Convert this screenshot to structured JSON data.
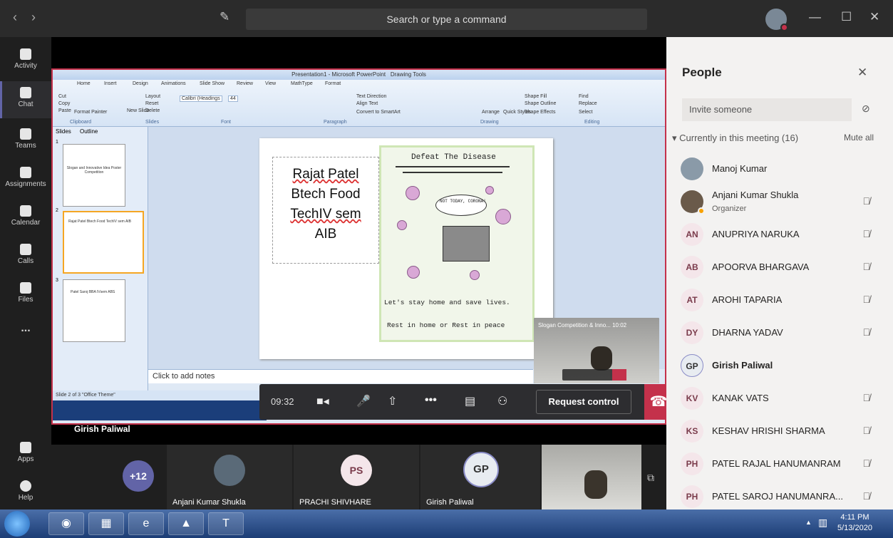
{
  "topbar": {
    "search_placeholder": "Search or type a command",
    "back": "‹",
    "forward": "›"
  },
  "rail": [
    {
      "label": "Activity"
    },
    {
      "label": "Chat"
    },
    {
      "label": "Teams"
    },
    {
      "label": "Assignments"
    },
    {
      "label": "Calendar"
    },
    {
      "label": "Calls"
    },
    {
      "label": "Files"
    },
    {
      "label": "..."
    },
    {
      "label": "Apps"
    },
    {
      "label": "Help"
    }
  ],
  "ppt": {
    "title": "Presentation1 - Microsoft PowerPoint",
    "drawing_tools": "Drawing Tools",
    "tabs": [
      "Home",
      "Insert",
      "Design",
      "Animations",
      "Slide Show",
      "Review",
      "View",
      "MathType",
      "Format"
    ],
    "groups": [
      "Clipboard",
      "Slides",
      "Font",
      "Paragraph",
      "Drawing",
      "Editing"
    ],
    "font_box": "Calibri (Headings",
    "font_size": "44",
    "ribbon_items": [
      "Cut",
      "Copy",
      "Paste",
      "Format Painter",
      "New Slide",
      "Layout",
      "Reset",
      "Delete",
      "Text Direction",
      "Align Text",
      "Convert to SmartArt",
      "Arrange",
      "Quick Styles",
      "Shape Fill",
      "Shape Outline",
      "Shape Effects",
      "Find",
      "Replace",
      "Select"
    ],
    "panel_tabs": [
      "Slides",
      "Outline"
    ],
    "thumbs": [
      {
        "num": "1",
        "text": "Slogan and Innovative Idea Poster Competition"
      },
      {
        "num": "2",
        "text": "Rajat Patel Btech Food TechIV sem AIB"
      },
      {
        "num": "3",
        "text": "Patel Saroj BBA IVsem ABS"
      }
    ],
    "slide_lines": [
      "Rajat Patel",
      "Btech Food",
      "TechIV sem",
      "AIB"
    ],
    "poster": {
      "title": "Defeat The Disease",
      "bubble": "NOT TODAY, CORONA!",
      "line1": "Let's stay home and save lives.",
      "line2": "Rest in home or Rest in peace"
    },
    "notes": "Click to add notes",
    "status": "Slide 2 of 3  \"Office Theme\""
  },
  "pip": {
    "title": "Slogan Competition & Inno...",
    "time": "10:02"
  },
  "controls": {
    "timer": "09:32",
    "request": "Request control"
  },
  "presenter": "Girish Paliwal",
  "gallery": [
    {
      "initials": "+12",
      "name": ""
    },
    {
      "initials": "",
      "name": "Anjani Kumar Shukla"
    },
    {
      "initials": "PS",
      "name": "PRACHI SHIVHARE"
    },
    {
      "initials": "GP",
      "name": "Girish Paliwal"
    },
    {
      "initials": "",
      "name": ""
    }
  ],
  "people": {
    "title": "People",
    "invite_placeholder": "Invite someone",
    "current": "Currently in this meeting (16)",
    "mute_all": "Mute all",
    "list": [
      {
        "initials": "",
        "name": "Manoj Kumar",
        "role": ""
      },
      {
        "initials": "",
        "name": "Anjani Kumar Shukla",
        "role": "Organizer"
      },
      {
        "initials": "AN",
        "name": "ANUPRIYA NARUKA",
        "role": ""
      },
      {
        "initials": "AB",
        "name": "APOORVA BHARGAVA",
        "role": ""
      },
      {
        "initials": "AT",
        "name": "AROHI TAPARIA",
        "role": ""
      },
      {
        "initials": "DY",
        "name": "DHARNA YADAV",
        "role": ""
      },
      {
        "initials": "GP",
        "name": "Girish Paliwal",
        "role": ""
      },
      {
        "initials": "KV",
        "name": "KANAK VATS",
        "role": ""
      },
      {
        "initials": "KS",
        "name": "KESHAV HRISHI SHARMA",
        "role": ""
      },
      {
        "initials": "PH",
        "name": "PATEL RAJAL HANUMANRAM",
        "role": ""
      },
      {
        "initials": "PH",
        "name": "PATEL SAROJ HANUMANRA...",
        "role": ""
      }
    ]
  },
  "taskbar": {
    "time": "4:11 PM",
    "date": "5/13/2020"
  },
  "colors": {
    "accent": "#6264a7",
    "hangup": "#c4314b",
    "panel": "#f3f2f1"
  }
}
